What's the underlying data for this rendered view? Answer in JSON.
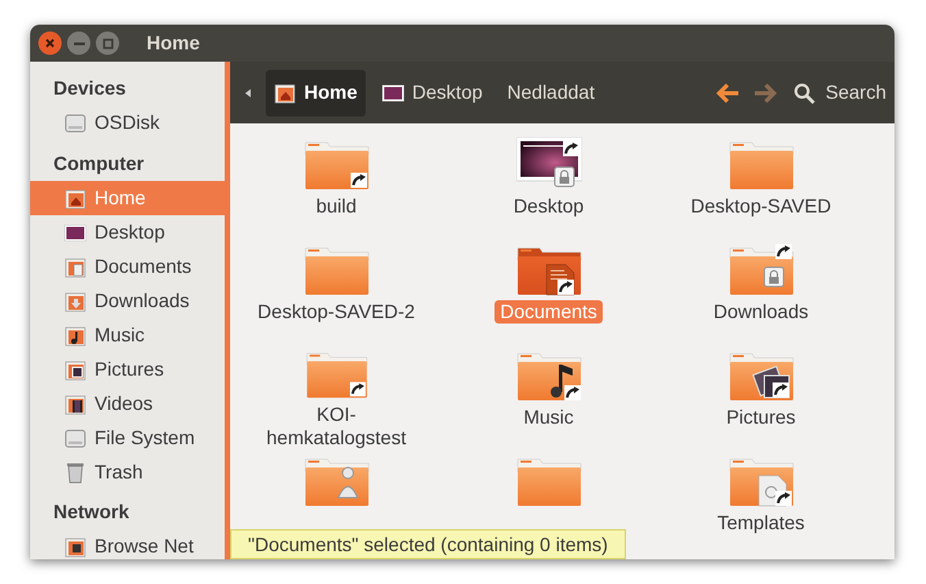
{
  "window": {
    "title": "Home"
  },
  "toolbar": {
    "path": [
      {
        "label": "Home",
        "kind": "home",
        "selected": true
      },
      {
        "label": "Desktop",
        "kind": "desktop",
        "selected": false
      },
      {
        "label": "Nedladdat",
        "kind": "none",
        "selected": false
      }
    ],
    "back_disabled": false,
    "forward_disabled": true,
    "search": "Search"
  },
  "sidebar": [
    {
      "heading": "Devices",
      "items": [
        {
          "label": "OSDisk",
          "kind": "drive",
          "selected": false
        }
      ]
    },
    {
      "heading": "Computer",
      "items": [
        {
          "label": "Home",
          "kind": "home",
          "selected": true
        },
        {
          "label": "Desktop",
          "kind": "desktop",
          "selected": false
        },
        {
          "label": "Documents",
          "kind": "documents",
          "selected": false
        },
        {
          "label": "Downloads",
          "kind": "downloads",
          "selected": false
        },
        {
          "label": "Music",
          "kind": "music",
          "selected": false
        },
        {
          "label": "Pictures",
          "kind": "pictures",
          "selected": false
        },
        {
          "label": "Videos",
          "kind": "videos",
          "selected": false
        },
        {
          "label": "File System",
          "kind": "drive",
          "selected": false
        },
        {
          "label": "Trash",
          "kind": "trash",
          "selected": false
        }
      ]
    },
    {
      "heading": "Network",
      "items": [
        {
          "label": "Browse Net",
          "kind": "network",
          "selected": false
        }
      ]
    }
  ],
  "files": [
    {
      "label": "build",
      "kind": "link",
      "selected": false
    },
    {
      "label": "Desktop",
      "kind": "desktop",
      "selected": false
    },
    {
      "label": "Desktop-SAVED",
      "kind": "plain",
      "selected": false
    },
    {
      "label": "Desktop-SAVED-2",
      "kind": "plain",
      "selected": false
    },
    {
      "label": "Documents",
      "kind": "documents",
      "selected": true
    },
    {
      "label": "Downloads",
      "kind": "locked",
      "selected": false
    },
    {
      "label": "KOI-hemkatalogstest",
      "kind": "link",
      "selected": false
    },
    {
      "label": "Music",
      "kind": "music",
      "selected": false
    },
    {
      "label": "Pictures",
      "kind": "pictures",
      "selected": false
    },
    {
      "kind": "person",
      "selected": false
    },
    {
      "kind": "plain",
      "selected": false
    },
    {
      "label": "Templates",
      "kind": "templates",
      "selected": false
    }
  ],
  "status": "\"Documents\" selected (containing 0 items)"
}
